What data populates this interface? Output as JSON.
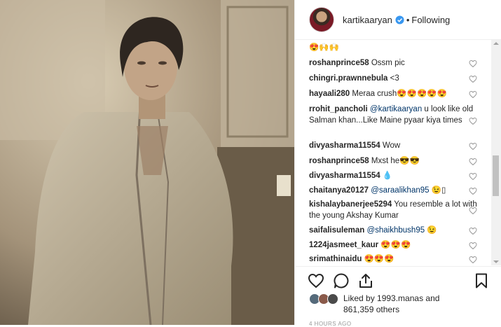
{
  "post": {
    "username": "kartikaaryan",
    "separator": "•",
    "follow_status": "Following"
  },
  "comments": [
    {
      "user": "",
      "text": "😍🙌🙌"
    },
    {
      "user": "roshanprince58",
      "text": "Ossm pic"
    },
    {
      "user": "chingri.prawnnebula",
      "text": "<3"
    },
    {
      "user": "hayaali280",
      "text": "Meraa crush😍😍😍😍😍"
    },
    {
      "user": "rrohit_pancholi",
      "mention": "@kartikaaryan",
      "text": "u look like old Salman khan...Like Maine pyaar kiya times"
    },
    {
      "user": "divyasharma11554",
      "text": "Wow"
    },
    {
      "user": "roshanprince58",
      "text": "Mxst he😎😎"
    },
    {
      "user": "divyasharma11554",
      "text": "💧"
    },
    {
      "user": "chaitanya20127",
      "mention": "@saraalikhan95",
      "text": "😉▯"
    },
    {
      "user": "kishalaybanerjee5294",
      "text": "You resemble a lot with the young Akshay Kumar"
    },
    {
      "user": "saifalisuleman",
      "mention": "@shaikhbush95",
      "text": "😉"
    },
    {
      "user": "1224jasmeet_kaur",
      "text": "😍😍😍"
    },
    {
      "user": "srimathinaidu",
      "text": "😍😍😍"
    }
  ],
  "actions": {
    "like_icon": "heart-outline-icon",
    "comment_icon": "speech-bubble-icon",
    "share_icon": "share-icon",
    "save_icon": "bookmark-icon"
  },
  "likes": {
    "prefix": "Liked by ",
    "by_user": "1993.manas",
    "middle": " and",
    "count": "861,359 others"
  },
  "timestamp": "4 HOURS AGO",
  "colors": {
    "verified": "#3897f0",
    "text": "#262626",
    "mention": "#003569",
    "border": "#efefef"
  }
}
